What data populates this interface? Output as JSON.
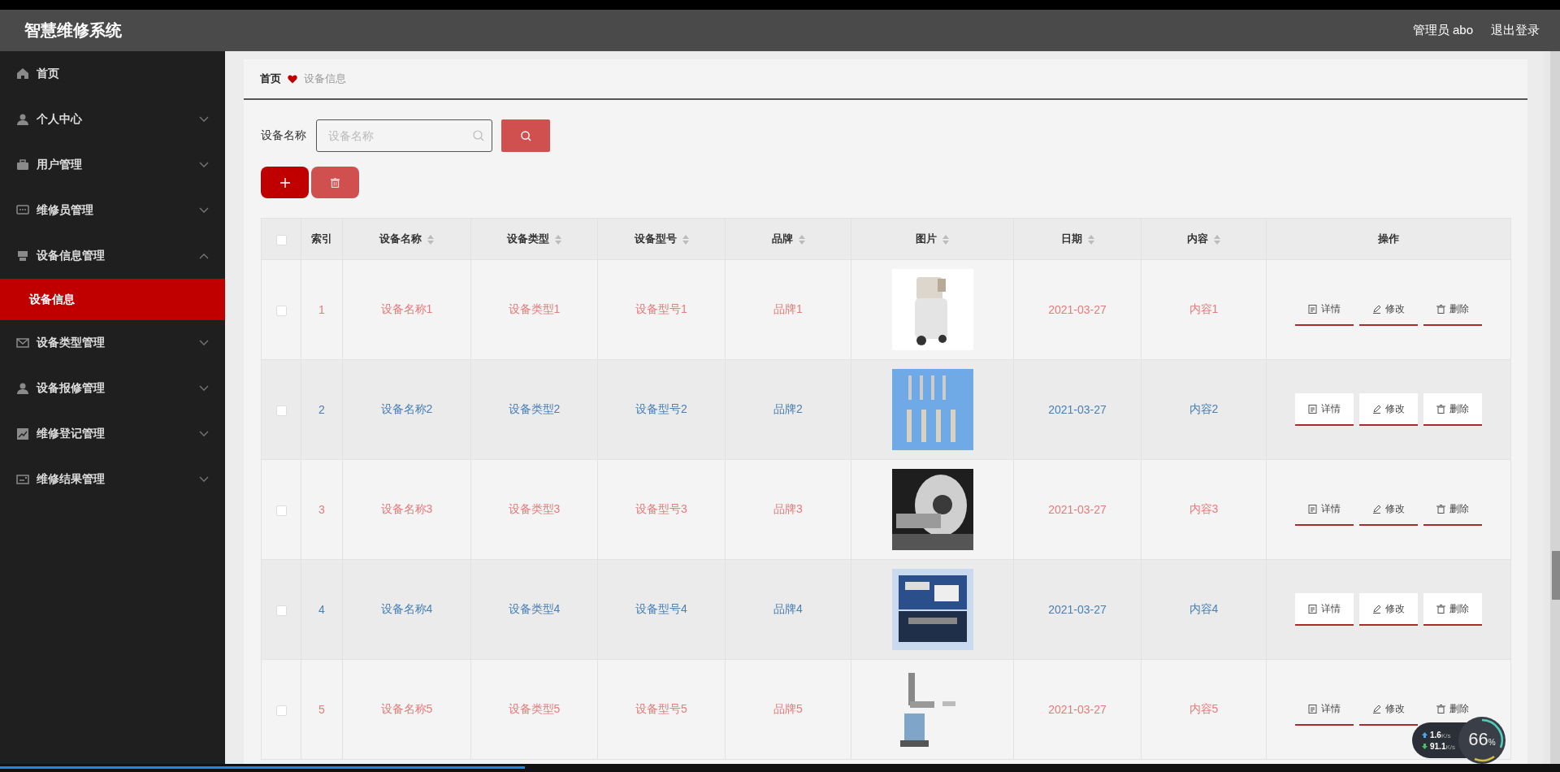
{
  "header": {
    "title": "智慧维修系统",
    "user": "管理员 abo",
    "logout": "退出登录"
  },
  "sidebar": {
    "items": [
      {
        "label": "首页"
      },
      {
        "label": "个人中心",
        "expanded": false
      },
      {
        "label": "用户管理",
        "expanded": false
      },
      {
        "label": "维修员管理",
        "expanded": false
      },
      {
        "label": "设备信息管理",
        "expanded": true,
        "children": [
          {
            "label": "设备信息",
            "selected": true
          }
        ]
      },
      {
        "label": "设备类型管理",
        "expanded": false
      },
      {
        "label": "设备报修管理",
        "expanded": false
      },
      {
        "label": "维修登记管理",
        "expanded": false
      },
      {
        "label": "维修结果管理",
        "expanded": false
      }
    ]
  },
  "breadcrumb": [
    "首页",
    "设备信息"
  ],
  "search": {
    "label": "设备名称",
    "placeholder": "设备名称"
  },
  "table": {
    "select_all": {
      "checked": false
    },
    "columns": [
      {
        "label": "索引",
        "sortable": false
      },
      {
        "label": "设备名称",
        "sortable": true
      },
      {
        "label": "设备类型",
        "sortable": true
      },
      {
        "label": "设备型号",
        "sortable": true
      },
      {
        "label": "品牌",
        "sortable": true
      },
      {
        "label": "图片",
        "sortable": true
      },
      {
        "label": "日期",
        "sortable": true
      },
      {
        "label": "内容",
        "sortable": true
      },
      {
        "label": "操作",
        "sortable": false
      }
    ],
    "rows": [
      {
        "checked": false,
        "cells": [
          "1",
          "设备名称1",
          "设备类型1",
          "设备型号1",
          "品牌1"
        ],
        "date": "2021-03-27",
        "content": "内容1",
        "actions": [
          "详情",
          "修改",
          "删除"
        ]
      },
      {
        "checked": false,
        "cells": [
          "2",
          "设备名称2",
          "设备类型2",
          "设备型号2",
          "品牌2"
        ],
        "date": "2021-03-27",
        "content": "内容2",
        "actions": [
          "详情",
          "修改",
          "删除"
        ]
      },
      {
        "checked": false,
        "cells": [
          "3",
          "设备名称3",
          "设备类型3",
          "设备型号3",
          "品牌3"
        ],
        "date": "2021-03-27",
        "content": "内容3",
        "actions": [
          "详情",
          "修改",
          "删除"
        ]
      },
      {
        "checked": false,
        "cells": [
          "4",
          "设备名称4",
          "设备类型4",
          "设备型号4",
          "品牌4"
        ],
        "date": "2021-03-27",
        "content": "内容4",
        "actions": [
          "详情",
          "修改",
          "删除"
        ]
      },
      {
        "checked": false,
        "cells": [
          "5",
          "设备名称5",
          "设备类型5",
          "设备型号5",
          "品牌5"
        ],
        "date": "2021-03-27",
        "content": "内容5",
        "actions": [
          "详情",
          "修改",
          "删除"
        ]
      }
    ]
  },
  "speed_widget": {
    "up": "1.6",
    "up_unit": "K/s",
    "down": "91.1",
    "down_unit": "K/s",
    "percent": "66",
    "percent_sign": "%"
  },
  "video_progress": {
    "level": 0.336
  }
}
